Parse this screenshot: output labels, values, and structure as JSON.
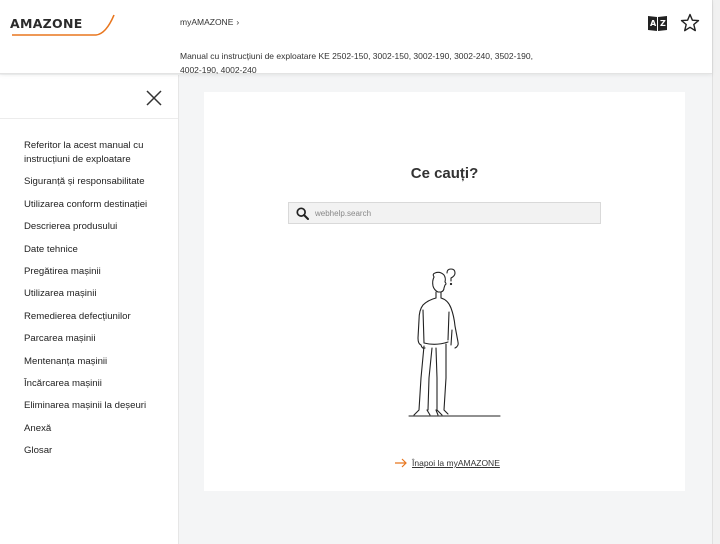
{
  "header": {
    "logo_text": "AMAZONE",
    "breadcrumb": {
      "home": "myAMAZONE",
      "separator": "›"
    },
    "doc_title": "Manual cu instrucțiuni de exploatare KE 2502-150, 3002-150, 3002-190, 3002-240, 3502-190, 4002-190, 4002-240",
    "icons": [
      "glossary-book-icon",
      "favorite-star-icon"
    ]
  },
  "sidebar": {
    "close_icon": "close-icon",
    "items": [
      {
        "label": "Referitor la acest manual cu instrucțiuni de exploatare"
      },
      {
        "label": "Siguranță și responsabilitate"
      },
      {
        "label": "Utilizarea conform destinației"
      },
      {
        "label": "Descrierea produsului"
      },
      {
        "label": "Date tehnice"
      },
      {
        "label": "Pregătirea mașinii"
      },
      {
        "label": "Utilizarea mașinii"
      },
      {
        "label": "Remedierea defecțiunilor"
      },
      {
        "label": "Parcarea mașinii"
      },
      {
        "label": "Mentenanța mașinii"
      },
      {
        "label": "Încărcarea mașinii"
      },
      {
        "label": "Eliminarea mașinii la deșeuri"
      },
      {
        "label": "Anexă"
      },
      {
        "label": "Glosar"
      }
    ]
  },
  "main": {
    "heading": "Ce cauți?",
    "search": {
      "placeholder": "webhelp.search",
      "value": ""
    },
    "illustration_icon": "questioning-person-illustration",
    "back_link": "Înapoi la myAMAZONE"
  },
  "colors": {
    "accent": "#e8761e",
    "text": "#222222",
    "background": "#f4f5f6"
  }
}
